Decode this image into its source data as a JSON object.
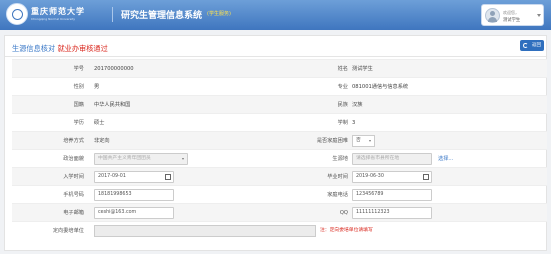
{
  "header": {
    "logo_text": "重庆师范大学",
    "logo_subtext": "Chongqing Normal University",
    "system_title": "研究生管理信息系统",
    "system_tag": "(学生服务)"
  },
  "user": {
    "welcome": "欢迎您，",
    "name": "测试学生"
  },
  "page": {
    "breadcrumb_link": "生源信息核对",
    "breadcrumb_current": "就业办审核通过",
    "back_label": "返回"
  },
  "rows": {
    "r1": {
      "left_label": "学号",
      "left_value": "201700000000",
      "right_label": "姓名",
      "right_value": "测试学生"
    },
    "r2": {
      "left_label": "性别",
      "left_value": "男",
      "right_label": "专业",
      "right_value": "081001通信与信息系统"
    },
    "r3": {
      "left_label": "国籍",
      "left_value": "中华人民共和国",
      "right_label": "民族",
      "right_value": "汉族"
    },
    "r4": {
      "left_label": "学历",
      "left_value": "硕士",
      "right_label": "学制",
      "right_value": "3"
    },
    "r5": {
      "left_label": "培养方式",
      "left_value": "非定向",
      "right_label": "是否家庭困难",
      "right_value": "否"
    },
    "r6": {
      "left_label": "政治面貌",
      "left_value": "中国共产主义青年团团员",
      "right_label": "生源地",
      "right_value": "请选择省市县所在地",
      "link": "选择..."
    },
    "r7": {
      "left_label": "入学时间",
      "left_value": "2017-09-01",
      "right_label": "毕业时间",
      "right_value": "2019-06-30"
    },
    "r8": {
      "left_label": "手机号码",
      "left_value": "18181998653",
      "right_label": "家庭电话",
      "right_value": "123456789"
    },
    "r9": {
      "left_label": "电子邮箱",
      "left_value": "ceshi@163.com",
      "right_label": "QQ",
      "right_value": "11111112323"
    },
    "r10": {
      "left_label": "定向委培单位",
      "note": "注：定向委培单位请填写"
    }
  },
  "colors": {
    "header_blue": "#3f76bf",
    "link_blue": "#3a78c7",
    "alert_red": "#d9261c"
  }
}
